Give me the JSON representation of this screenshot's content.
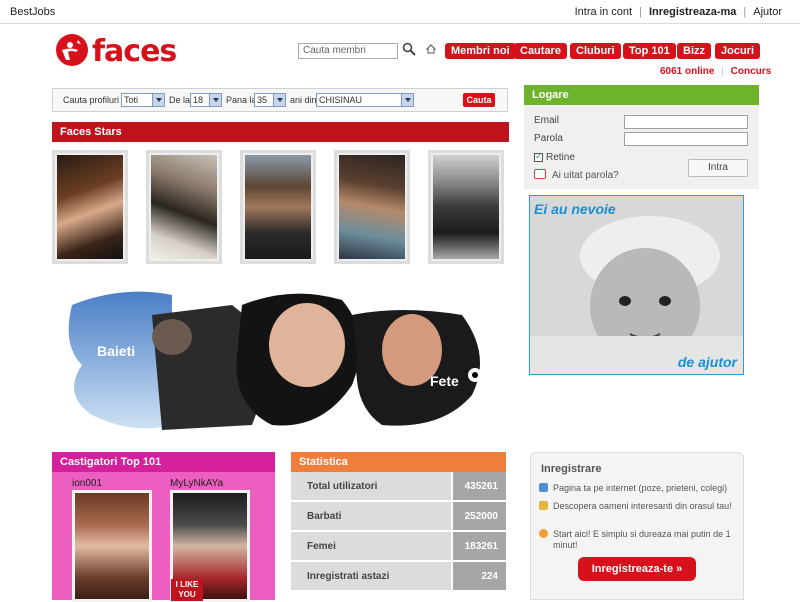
{
  "topbar": {
    "left_items": [
      "",
      "BestJobs"
    ],
    "login": "Intra in cont",
    "register": "Inregistreaza-ma",
    "help": "Ajutor"
  },
  "logo": {
    "text": "faces"
  },
  "search": {
    "placeholder": "Cauta membri"
  },
  "nav": {
    "items": [
      "Membri noi",
      "Cautare",
      "Cluburi",
      "Top 101",
      "Bizz",
      "Jocuri"
    ],
    "online_count": "6061",
    "online_label": "online",
    "concurs": "Concurs"
  },
  "profile_search": {
    "label": "Cauta profiluri",
    "gender": "Toti",
    "from_label": "De la",
    "age_from": "18",
    "to_label": "Pana la",
    "age_to": "35",
    "from_city_label": "ani din",
    "city": "CHISINAU",
    "button": "Cauta"
  },
  "stars": {
    "title": "Faces Stars"
  },
  "banner": {
    "left_label": "Baieti",
    "right_label": "Fete"
  },
  "login": {
    "title": "Logare",
    "email_label": "Email",
    "password_label": "Parola",
    "remember_label": "Retine",
    "forgot_label": "Ai uitat parola?",
    "submit": "Intra"
  },
  "ad": {
    "top_text": "Ei au nevoie",
    "bottom_text": "de ajutor"
  },
  "top101": {
    "title": "Castigatori Top 101",
    "winners": [
      "ion001",
      "MyLyNkAYa"
    ],
    "badge": "I LIKE YOU"
  },
  "stats": {
    "title": "Statistica",
    "rows": [
      {
        "label": "Total utilizatori",
        "value": "435261"
      },
      {
        "label": "Barbati",
        "value": "252000"
      },
      {
        "label": "Femei",
        "value": "183261"
      },
      {
        "label": "Inregistrati astazi",
        "value": "224"
      }
    ]
  },
  "register": {
    "title": "Inregistrare",
    "items": [
      "Pagina ta pe internet (poze, prieteni, colegi)",
      "Descopera oameni interesanti din orasul tau!",
      "Start aici! E simplu si dureaza mai putin de 1 minut!"
    ],
    "button": "Inregistreaza-te »"
  },
  "colors": {
    "brand_red": "#d6111b",
    "login_green": "#6fb32c",
    "top_pink": "#d61f9a",
    "stats_orange": "#ef7d3c"
  }
}
